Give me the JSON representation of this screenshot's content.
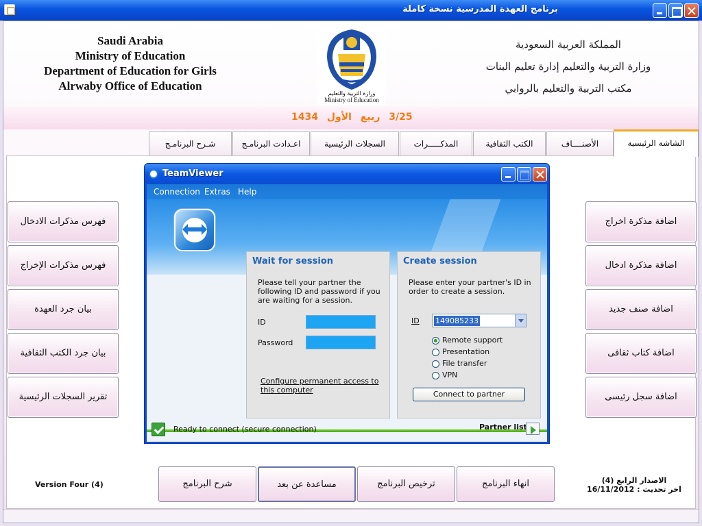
{
  "window": {
    "title": "برنامج العهدة المدرسية   نسخة كاملة"
  },
  "header": {
    "english_lines": [
      "Saudi Arabia",
      "Ministry of Education",
      "Department of Education for Girls",
      "Alrwaby Office of Education"
    ],
    "arabic_lines": [
      "المملكة العربية السعودية",
      "وزارة التربية والتعليم إدارة تعليم البنات",
      "مكتب التربية والتعليم بالروابي"
    ],
    "logo_caption_ar": "وزارة التربية والتعليم",
    "logo_caption_en": "Ministry of Education"
  },
  "date": {
    "day": "3/25",
    "month": "ربيع الأول",
    "year": "1434"
  },
  "tabs": [
    {
      "label": "الشاشة الرئيسية",
      "active": true
    },
    {
      "label": "الأصنــــاف"
    },
    {
      "label": "الكتب الثقافية"
    },
    {
      "label": "المذكـــــرات"
    },
    {
      "label": "السجلات الرئيسية"
    },
    {
      "label": "اعـدادت البرنامـج"
    },
    {
      "label": "شـرح البرنامـج"
    }
  ],
  "right_buttons": [
    "اضافة مذكرة اخراج",
    "اضافة مذكرة ادخال",
    "اضافة صنف جديد",
    "اضافة كتاب ثقافى",
    "اضافة سجل رئيسى"
  ],
  "left_buttons": [
    "فهرس مذكرات الادخال",
    "فهرس مذكرات الإخراج",
    "بيان جرد العهدة",
    "بيان جرد الكتب الثقافية",
    "تقرير السجلات الرئيسية"
  ],
  "bottom_buttons": [
    "انهاء البرنامج",
    "ترخيص البرنامج",
    "مساعدة عن بعد",
    "شرح البرنامج"
  ],
  "version": {
    "english": "Version Four (4)",
    "arabic_line1": "الاصدار الرابع (4)",
    "arabic_line2": "اخر تحديث : 16/11/2012"
  },
  "teamviewer": {
    "title": "TeamViewer",
    "menu": [
      "Connection",
      "Extras",
      "Help"
    ],
    "wait": {
      "title": "Wait for session",
      "description": "Please tell your partner the following ID and password if you are waiting for a session.",
      "id_label": "ID",
      "password_label": "Password",
      "link": "Configure permanent access to this computer"
    },
    "create": {
      "title": "Create session",
      "description": "Please enter your partner's ID in order to create a session.",
      "id_label": "ID",
      "id_value": "149085233",
      "options": [
        "Remote support",
        "Presentation",
        "File transfer",
        "VPN"
      ],
      "selected_option": "Remote support",
      "connect_button": "Connect to partner"
    },
    "status": "Ready to connect (secure connection)",
    "partner_list": "Partner list"
  }
}
